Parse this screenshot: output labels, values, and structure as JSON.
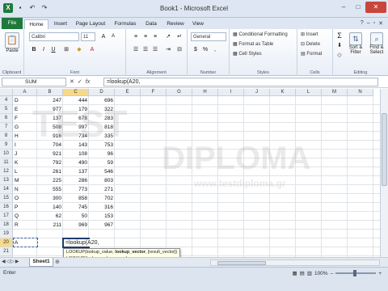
{
  "window": {
    "title": "Book1 - Microsoft Excel"
  },
  "tabs": [
    "File",
    "Home",
    "Insert",
    "Page Layout",
    "Formulas",
    "Data",
    "Review",
    "View"
  ],
  "ribbon": {
    "clipboard": {
      "paste": "Paste",
      "label": "Clipboard"
    },
    "font": {
      "name": "Calibri",
      "size": "11",
      "bold": "B",
      "italic": "I",
      "underline": "U",
      "label": "Font"
    },
    "alignment": {
      "label": "Alignment"
    },
    "number": {
      "format": "General",
      "currency": "$",
      "percent": "%",
      "comma": ",",
      "label": "Number"
    },
    "styles": {
      "conditional": "Conditional Formatting",
      "format_table": "Format as Table",
      "cell_styles": "Cell Styles",
      "label": "Styles"
    },
    "cells": {
      "insert": "Insert",
      "delete": "Delete",
      "format": "Format",
      "label": "Cells"
    },
    "editing": {
      "sum": "Σ",
      "sort": "Sort & Filter",
      "find": "Find & Select",
      "label": "Editing"
    }
  },
  "formula_bar": {
    "name_box": "SUM",
    "cancel": "✕",
    "enter": "✓",
    "fx": "fx",
    "formula": "=lookup(A20,"
  },
  "columns": [
    "A",
    "B",
    "C",
    "D",
    "E",
    "F",
    "G",
    "H",
    "I",
    "J",
    "K",
    "L",
    "M",
    "N"
  ],
  "rows": [
    {
      "n": "4",
      "b": "D",
      "c": "247",
      "d": "444",
      "e": "696"
    },
    {
      "n": "5",
      "b": "E",
      "c": "977",
      "d": "179",
      "e": "322"
    },
    {
      "n": "6",
      "b": "F",
      "c": "137",
      "d": "678",
      "e": "283"
    },
    {
      "n": "7",
      "b": "G",
      "c": "508",
      "d": "997",
      "e": "818"
    },
    {
      "n": "8",
      "b": "H",
      "c": "916",
      "d": "734",
      "e": "335"
    },
    {
      "n": "9",
      "b": "I",
      "c": "704",
      "d": "143",
      "e": "753"
    },
    {
      "n": "10",
      "b": "J",
      "c": "921",
      "d": "108",
      "e": "96"
    },
    {
      "n": "11",
      "b": "K",
      "c": "792",
      "d": "490",
      "e": "59"
    },
    {
      "n": "12",
      "b": "L",
      "c": "261",
      "d": "137",
      "e": "546"
    },
    {
      "n": "13",
      "b": "M",
      "c": "225",
      "d": "286",
      "e": "803"
    },
    {
      "n": "14",
      "b": "N",
      "c": "555",
      "d": "773",
      "e": "271"
    },
    {
      "n": "15",
      "b": "O",
      "c": "300",
      "d": "858",
      "e": "702"
    },
    {
      "n": "16",
      "b": "P",
      "c": "140",
      "d": "745",
      "e": "316"
    },
    {
      "n": "17",
      "b": "Q",
      "c": "62",
      "d": "50",
      "e": "153"
    },
    {
      "n": "18",
      "b": "R",
      "c": "211",
      "d": "969",
      "e": "967"
    },
    {
      "n": "19",
      "b": "",
      "c": "",
      "d": "",
      "e": ""
    },
    {
      "n": "20",
      "b": "A",
      "c": "",
      "d": "",
      "e": ""
    },
    {
      "n": "21",
      "b": "",
      "c": "",
      "d": "",
      "e": ""
    },
    {
      "n": "22",
      "b": "",
      "c": "",
      "d": "",
      "e": ""
    }
  ],
  "edit_cell": {
    "text": "=lookup(A20,"
  },
  "tooltip": {
    "line1_fn": "LOOKUP(",
    "line1_a": "lookup_value, ",
    "line1_b": "lookup_vector",
    "line1_c": ", [result_vector])",
    "line2": "LOOKUP(lookup_value, ",
    "line2_b": "array",
    "line2_c": ")"
  },
  "watermark": {
    "a": "TEST",
    "b": "DIPLOMA",
    "c": "www.testdiploma.gr"
  },
  "sheets": {
    "active": "Sheet1"
  },
  "status": {
    "mode": "Enter",
    "zoom": "100%"
  }
}
